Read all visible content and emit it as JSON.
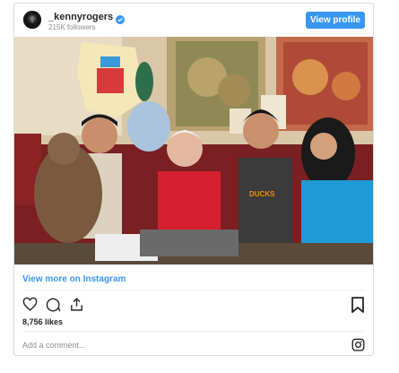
{
  "post": {
    "username": "_kennyrogers",
    "followers": "215K followers",
    "view_profile_label": "View profile",
    "photo": {
      "description_icon": "photo-icon"
    },
    "view_more_label": "View more on Instagram",
    "likes": "8,756 likes",
    "comment_placeholder": "Add a comment..."
  },
  "icons": {
    "verified": "verified-badge-icon",
    "like": "heart-icon",
    "comment": "comment-icon",
    "share": "share-icon",
    "save": "bookmark-icon",
    "instagram": "instagram-icon"
  },
  "colors": {
    "accent": "#3897f0",
    "border": "#dbdbdb",
    "muted": "#8e8e8e",
    "text": "#262626"
  }
}
